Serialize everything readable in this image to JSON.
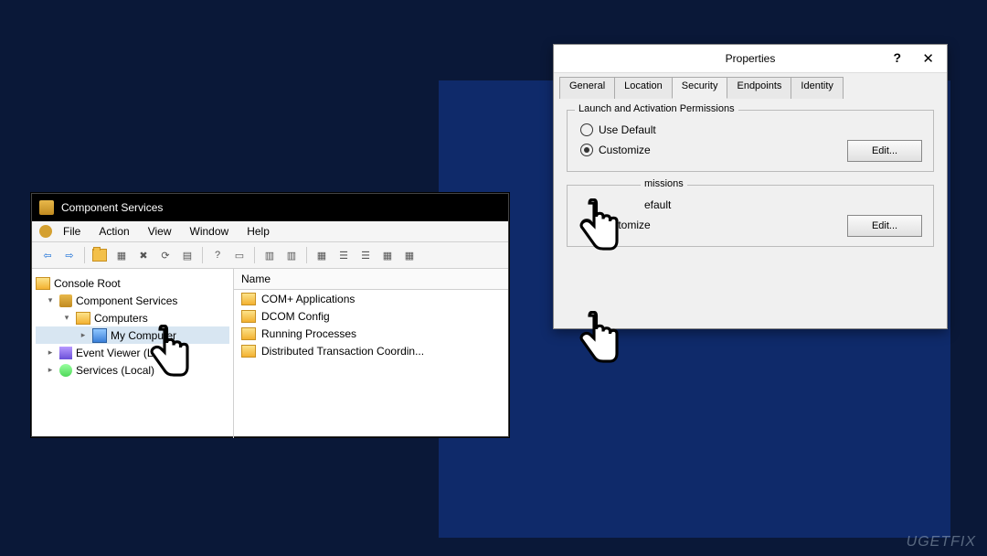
{
  "cs": {
    "title": "Component Services",
    "menu": {
      "file": "File",
      "action": "Action",
      "view": "View",
      "window": "Window",
      "help": "Help"
    },
    "tree": {
      "root": "Console Root",
      "comp_services": "Component Services",
      "computers": "Computers",
      "my_computer": "My Computer",
      "event_viewer": "Event Viewer (Local)",
      "services": "Services (Local)"
    },
    "list_header": "Name",
    "list_items": [
      "COM+ Applications",
      "DCOM Config",
      "Running Processes",
      "Distributed Transaction Coordin..."
    ]
  },
  "prop": {
    "title": "Properties",
    "tabs": {
      "general": "General",
      "location": "Location",
      "security": "Security",
      "endpoints": "Endpoints",
      "identity": "Identity"
    },
    "group1": {
      "title": "Launch and Activation Permissions",
      "opt_default": "Use Default",
      "opt_custom": "Customize",
      "edit": "Edit..."
    },
    "group2": {
      "title_fragment": "missions",
      "opt_default_fragment": "efault",
      "opt_custom": "Customize",
      "edit": "Edit..."
    }
  },
  "watermark": "UGETFIX"
}
